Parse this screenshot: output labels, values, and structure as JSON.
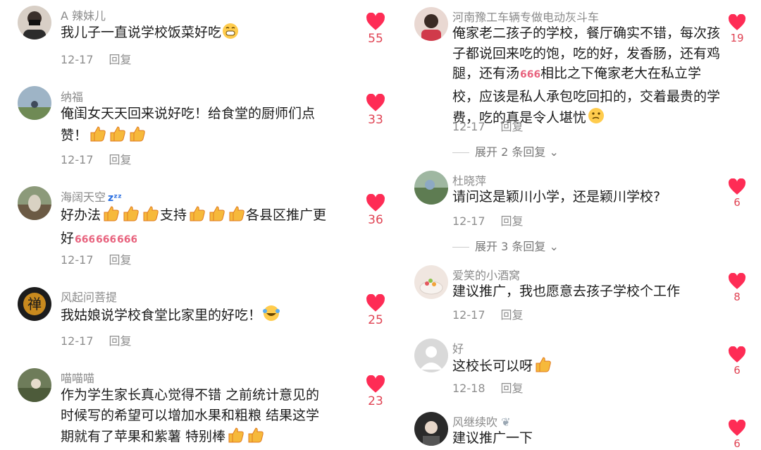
{
  "colors": {
    "like": "#fe2c55",
    "count": "#e04454",
    "meta": "#8e8e8e"
  },
  "left": [
    {
      "username": "A 辣妹儿",
      "lines": [
        "我儿子一直说学校饭菜好吃"
      ],
      "date": "12-17",
      "reply": "回复",
      "likes": "55"
    },
    {
      "username": "纳福",
      "lines": [
        "俺闺女天天回来说好吃！给食堂的厨师们点",
        "赞！"
      ],
      "date": "12-17",
      "reply": "回复",
      "likes": "33"
    },
    {
      "username": "海阔天空",
      "lines": [
        "好办法",
        "支持",
        "各县区推广更",
        "好"
      ],
      "date": "12-17",
      "reply": "回复",
      "likes": "36"
    },
    {
      "username": "风起问菩提",
      "lines": [
        "我姑娘说学校食堂比家里的好吃！"
      ],
      "date": "12-17",
      "reply": "回复",
      "likes": "25"
    },
    {
      "username": "喵喵喵",
      "lines": [
        "作为学生家长真心觉得不错 之前统计意见的",
        "时候写的希望可以增加水果和粗粮 结果这学",
        "期就有了苹果和紫薯 特别棒"
      ],
      "likes": "23"
    }
  ],
  "right": [
    {
      "username": "河南豫工车辆专做电动灰斗车",
      "lines": [
        "俺家老二孩子的学校，餐厅确实不错，每次孩",
        "子都说回来吃的饱，吃的好，发香肠，还有鸡",
        "腿，还有汤",
        "相比之下俺家老大在私立学",
        "校，应该是私人承包吃回扣的，交着最贵的学",
        "费，吃的真是令人堪忧"
      ],
      "date": "12-17",
      "reply": "回复",
      "likes": "19",
      "expand": "展开 2 条回复"
    },
    {
      "username": "杜晓萍",
      "lines": [
        "请问这是颖川小学，还是颖川学校?"
      ],
      "date": "12-17",
      "reply": "回复",
      "likes": "6",
      "expand": "展开 3 条回复"
    },
    {
      "username": "爱笑的小酒窝",
      "lines": [
        "建议推广，我也愿意去孩子学校个工作"
      ],
      "date": "12-17",
      "reply": "回复",
      "likes": "8"
    },
    {
      "username": "好",
      "lines": [
        "这校长可以呀"
      ],
      "date": "12-18",
      "reply": "回复",
      "likes": "6"
    },
    {
      "username": "风继续吹",
      "lines": [
        "建议推广一下"
      ],
      "likes": "6"
    }
  ]
}
